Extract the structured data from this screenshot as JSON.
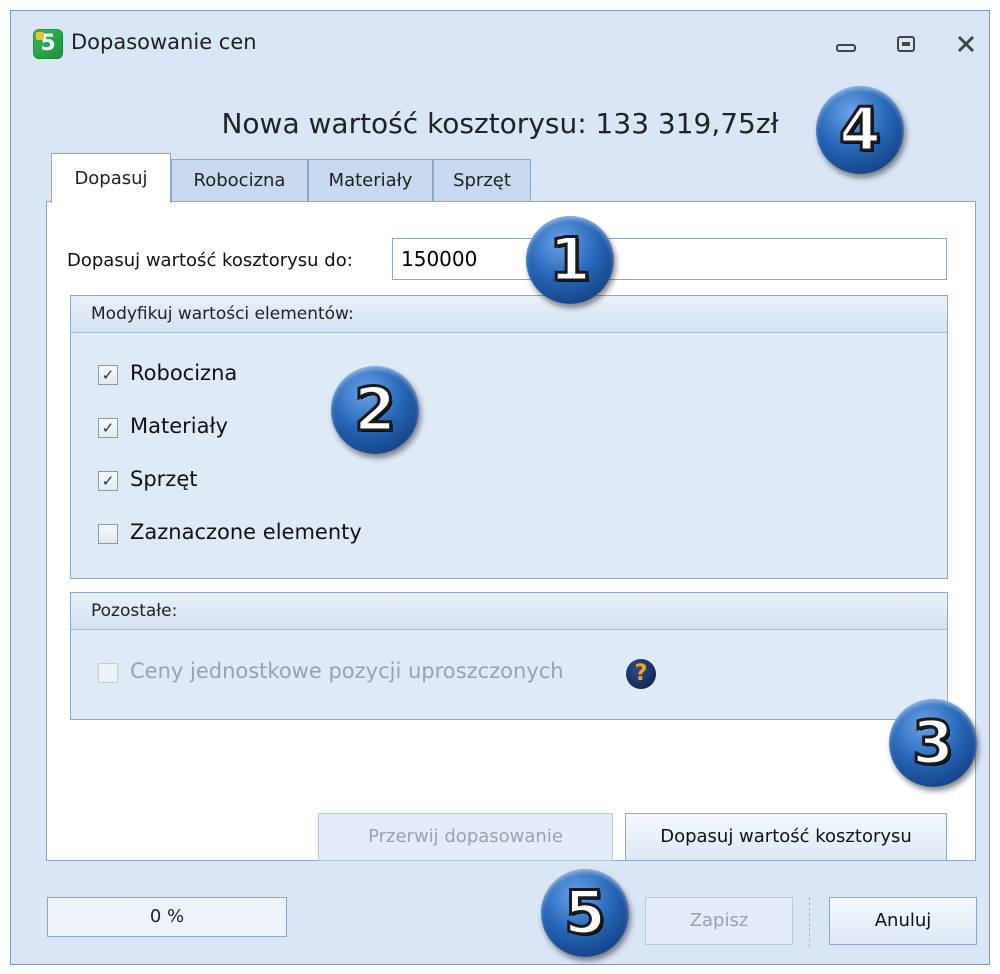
{
  "window": {
    "title": "Dopasowanie cen",
    "app_icon": "5"
  },
  "header": {
    "new_value": "Nowa wartość kosztorysu: 133 319,75zł"
  },
  "tabs": [
    {
      "label": "Dopasuj",
      "active": true
    },
    {
      "label": "Robocizna",
      "active": false
    },
    {
      "label": "Materiały",
      "active": false
    },
    {
      "label": "Sprzęt",
      "active": false
    }
  ],
  "target": {
    "label": "Dopasuj wartość kosztorysu do:",
    "value": "150000"
  },
  "modify_group": {
    "title": "Modyfikuj wartości elementów:",
    "items": [
      {
        "label": "Robocizna",
        "checked": true
      },
      {
        "label": "Materiały",
        "checked": true
      },
      {
        "label": "Sprzęt",
        "checked": true
      },
      {
        "label": "Zaznaczone elementy",
        "checked": false
      }
    ]
  },
  "other_group": {
    "title": "Pozostałe:",
    "item": {
      "label": "Ceny jednostkowe pozycji uproszczonych",
      "checked": false,
      "disabled": true
    },
    "help_icon": "?"
  },
  "buttons": {
    "stop": "Przerwij dopasowanie",
    "adjust": "Dopasuj wartość kosztorysu",
    "save": "Zapisz",
    "cancel": "Anuluj"
  },
  "progress": {
    "text": "0 %",
    "value": 0
  },
  "badges": [
    "1",
    "2",
    "3",
    "4",
    "5"
  ],
  "icons": [
    "minimize-icon",
    "restore-icon",
    "close-icon",
    "help-icon"
  ],
  "colors": {
    "window_bg": "#d9e6f6",
    "border": "#8ea8cc",
    "badge": "#2666b8",
    "help": "#f7a21b"
  }
}
